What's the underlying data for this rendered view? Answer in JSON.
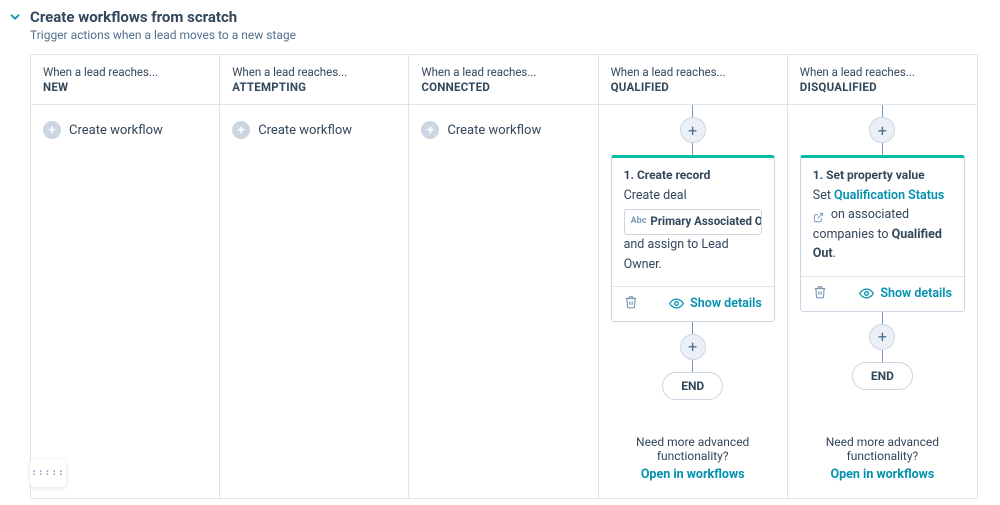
{
  "header": {
    "title": "Create workflows from scratch",
    "subtitle": "Trigger actions when a lead moves to a new stage"
  },
  "columnHeader": {
    "prefix": "When a lead reaches..."
  },
  "createWorkflowLabel": "Create workflow",
  "columns": [
    {
      "stage": "NEW"
    },
    {
      "stage": "ATTEMPTING"
    },
    {
      "stage": "CONNECTED"
    },
    {
      "stage": "QUALIFIED",
      "card": {
        "title": "1. Create record",
        "line1": "Create deal",
        "tokenText": "Primary Associated Object Name",
        "line2": "and assign to Lead Owner."
      }
    },
    {
      "stage": "DISQUALIFIED",
      "card": {
        "title": "1. Set property value",
        "setPrefix": "Set ",
        "propertyLink": "Qualification Status",
        "middleText": " on associated companies to ",
        "boldValue": "Qualified Out",
        "period": "."
      }
    }
  ],
  "cardFooter": {
    "showDetails": "Show details"
  },
  "endLabel": "END",
  "advanced": {
    "text": "Need more advanced functionality?",
    "link": "Open in workflows"
  }
}
